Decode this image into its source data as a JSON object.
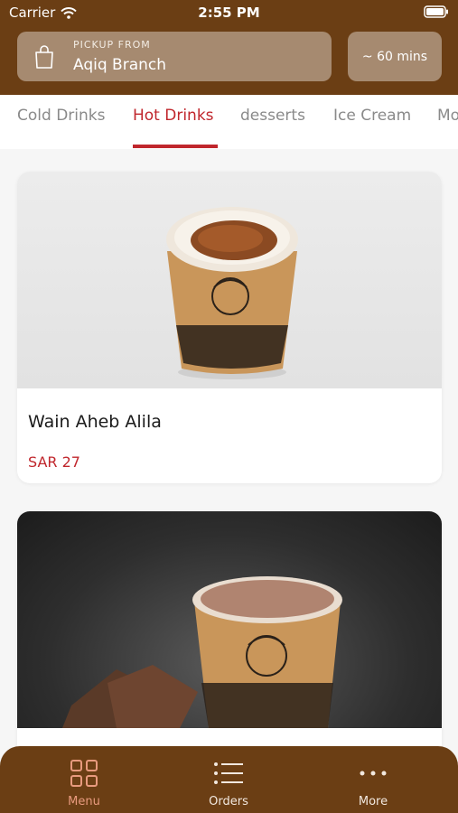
{
  "status": {
    "carrier": "Carrier",
    "time": "2:55 PM"
  },
  "header": {
    "pickup_label": "PICKUP FROM",
    "branch": "Aqiq Branch",
    "eta": "~ 60 mins"
  },
  "tabs": [
    {
      "label": "Cold Drinks"
    },
    {
      "label": "Hot Drinks"
    },
    {
      "label": "desserts"
    },
    {
      "label": "Ice Cream"
    },
    {
      "label": "Mo"
    }
  ],
  "items": [
    {
      "title": "Wain Aheb Alila",
      "price": "SAR 27"
    },
    {
      "title": "",
      "price": ""
    }
  ],
  "nav": [
    {
      "label": "Menu",
      "icon": "grid-icon"
    },
    {
      "label": "Orders",
      "icon": "list-icon"
    },
    {
      "label": "More",
      "icon": "more-icon"
    }
  ],
  "colors": {
    "brand": "#6b3e14",
    "accent": "#c0262c",
    "pill": "#a68a70"
  }
}
